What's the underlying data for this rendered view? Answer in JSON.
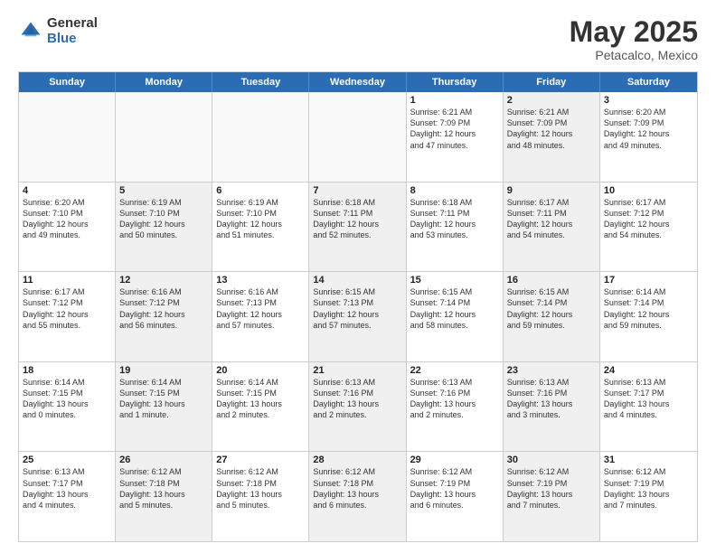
{
  "logo": {
    "general": "General",
    "blue": "Blue"
  },
  "title": "May 2025",
  "subtitle": "Petacalco, Mexico",
  "days": [
    "Sunday",
    "Monday",
    "Tuesday",
    "Wednesday",
    "Thursday",
    "Friday",
    "Saturday"
  ],
  "weeks": [
    [
      {
        "day": "",
        "text": "",
        "empty": true
      },
      {
        "day": "",
        "text": "",
        "empty": true
      },
      {
        "day": "",
        "text": "",
        "empty": true
      },
      {
        "day": "",
        "text": "",
        "empty": true
      },
      {
        "day": "1",
        "text": "Sunrise: 6:21 AM\nSunset: 7:09 PM\nDaylight: 12 hours\nand 47 minutes.",
        "empty": false
      },
      {
        "day": "2",
        "text": "Sunrise: 6:21 AM\nSunset: 7:09 PM\nDaylight: 12 hours\nand 48 minutes.",
        "empty": false,
        "shaded": true
      },
      {
        "day": "3",
        "text": "Sunrise: 6:20 AM\nSunset: 7:09 PM\nDaylight: 12 hours\nand 49 minutes.",
        "empty": false
      }
    ],
    [
      {
        "day": "4",
        "text": "Sunrise: 6:20 AM\nSunset: 7:10 PM\nDaylight: 12 hours\nand 49 minutes.",
        "empty": false
      },
      {
        "day": "5",
        "text": "Sunrise: 6:19 AM\nSunset: 7:10 PM\nDaylight: 12 hours\nand 50 minutes.",
        "empty": false,
        "shaded": true
      },
      {
        "day": "6",
        "text": "Sunrise: 6:19 AM\nSunset: 7:10 PM\nDaylight: 12 hours\nand 51 minutes.",
        "empty": false
      },
      {
        "day": "7",
        "text": "Sunrise: 6:18 AM\nSunset: 7:11 PM\nDaylight: 12 hours\nand 52 minutes.",
        "empty": false,
        "shaded": true
      },
      {
        "day": "8",
        "text": "Sunrise: 6:18 AM\nSunset: 7:11 PM\nDaylight: 12 hours\nand 53 minutes.",
        "empty": false
      },
      {
        "day": "9",
        "text": "Sunrise: 6:17 AM\nSunset: 7:11 PM\nDaylight: 12 hours\nand 54 minutes.",
        "empty": false,
        "shaded": true
      },
      {
        "day": "10",
        "text": "Sunrise: 6:17 AM\nSunset: 7:12 PM\nDaylight: 12 hours\nand 54 minutes.",
        "empty": false
      }
    ],
    [
      {
        "day": "11",
        "text": "Sunrise: 6:17 AM\nSunset: 7:12 PM\nDaylight: 12 hours\nand 55 minutes.",
        "empty": false
      },
      {
        "day": "12",
        "text": "Sunrise: 6:16 AM\nSunset: 7:12 PM\nDaylight: 12 hours\nand 56 minutes.",
        "empty": false,
        "shaded": true
      },
      {
        "day": "13",
        "text": "Sunrise: 6:16 AM\nSunset: 7:13 PM\nDaylight: 12 hours\nand 57 minutes.",
        "empty": false
      },
      {
        "day": "14",
        "text": "Sunrise: 6:15 AM\nSunset: 7:13 PM\nDaylight: 12 hours\nand 57 minutes.",
        "empty": false,
        "shaded": true
      },
      {
        "day": "15",
        "text": "Sunrise: 6:15 AM\nSunset: 7:14 PM\nDaylight: 12 hours\nand 58 minutes.",
        "empty": false
      },
      {
        "day": "16",
        "text": "Sunrise: 6:15 AM\nSunset: 7:14 PM\nDaylight: 12 hours\nand 59 minutes.",
        "empty": false,
        "shaded": true
      },
      {
        "day": "17",
        "text": "Sunrise: 6:14 AM\nSunset: 7:14 PM\nDaylight: 12 hours\nand 59 minutes.",
        "empty": false
      }
    ],
    [
      {
        "day": "18",
        "text": "Sunrise: 6:14 AM\nSunset: 7:15 PM\nDaylight: 13 hours\nand 0 minutes.",
        "empty": false
      },
      {
        "day": "19",
        "text": "Sunrise: 6:14 AM\nSunset: 7:15 PM\nDaylight: 13 hours\nand 1 minute.",
        "empty": false,
        "shaded": true
      },
      {
        "day": "20",
        "text": "Sunrise: 6:14 AM\nSunset: 7:15 PM\nDaylight: 13 hours\nand 2 minutes.",
        "empty": false
      },
      {
        "day": "21",
        "text": "Sunrise: 6:13 AM\nSunset: 7:16 PM\nDaylight: 13 hours\nand 2 minutes.",
        "empty": false,
        "shaded": true
      },
      {
        "day": "22",
        "text": "Sunrise: 6:13 AM\nSunset: 7:16 PM\nDaylight: 13 hours\nand 2 minutes.",
        "empty": false
      },
      {
        "day": "23",
        "text": "Sunrise: 6:13 AM\nSunset: 7:16 PM\nDaylight: 13 hours\nand 3 minutes.",
        "empty": false,
        "shaded": true
      },
      {
        "day": "24",
        "text": "Sunrise: 6:13 AM\nSunset: 7:17 PM\nDaylight: 13 hours\nand 4 minutes.",
        "empty": false
      }
    ],
    [
      {
        "day": "25",
        "text": "Sunrise: 6:13 AM\nSunset: 7:17 PM\nDaylight: 13 hours\nand 4 minutes.",
        "empty": false
      },
      {
        "day": "26",
        "text": "Sunrise: 6:12 AM\nSunset: 7:18 PM\nDaylight: 13 hours\nand 5 minutes.",
        "empty": false,
        "shaded": true
      },
      {
        "day": "27",
        "text": "Sunrise: 6:12 AM\nSunset: 7:18 PM\nDaylight: 13 hours\nand 5 minutes.",
        "empty": false
      },
      {
        "day": "28",
        "text": "Sunrise: 6:12 AM\nSunset: 7:18 PM\nDaylight: 13 hours\nand 6 minutes.",
        "empty": false,
        "shaded": true
      },
      {
        "day": "29",
        "text": "Sunrise: 6:12 AM\nSunset: 7:19 PM\nDaylight: 13 hours\nand 6 minutes.",
        "empty": false
      },
      {
        "day": "30",
        "text": "Sunrise: 6:12 AM\nSunset: 7:19 PM\nDaylight: 13 hours\nand 7 minutes.",
        "empty": false,
        "shaded": true
      },
      {
        "day": "31",
        "text": "Sunrise: 6:12 AM\nSunset: 7:19 PM\nDaylight: 13 hours\nand 7 minutes.",
        "empty": false
      }
    ]
  ]
}
